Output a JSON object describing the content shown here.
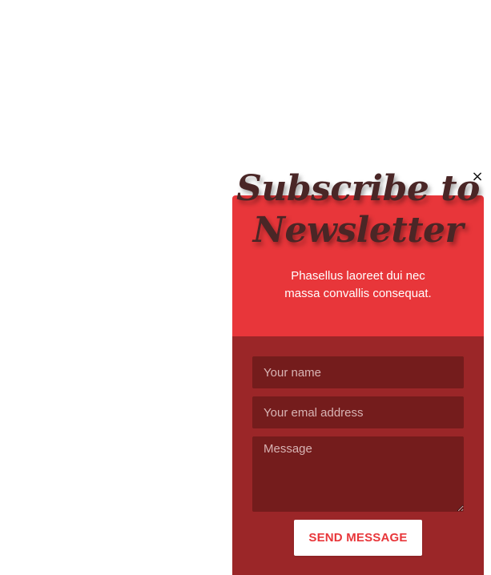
{
  "popup": {
    "close_label": "×",
    "headline_line1": "Subscribe to",
    "headline_line2": "Newsletter",
    "subtext_line1": "Phasellus laoreet dui nec",
    "subtext_line2": "massa convallis consequat.",
    "name_placeholder": "Your name",
    "email_placeholder": "Your emal address",
    "message_placeholder": "Message",
    "send_label": "SEND MESSAGE"
  },
  "colors": {
    "top_panel": "#e8363a",
    "bottom_panel": "#9b2628",
    "field_bg": "#741c1c",
    "headline": "#4a2626",
    "button_text": "#e8363a"
  },
  "icons": {
    "close": "close-icon"
  }
}
